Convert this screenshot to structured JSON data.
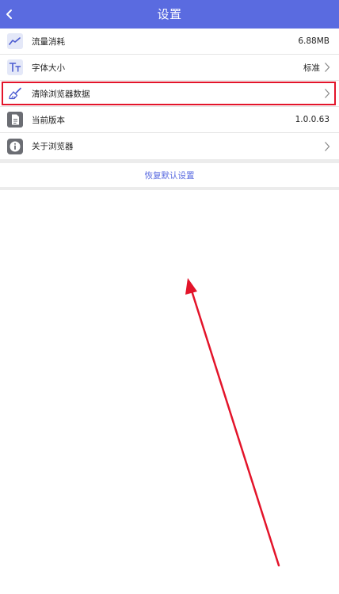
{
  "header": {
    "title": "设置",
    "background": "#5a6be0"
  },
  "settings": {
    "items": [
      {
        "icon": "traffic-chart-icon",
        "label": "流量消耗",
        "value": "6.88MB"
      },
      {
        "icon": "font-size-icon",
        "label": "字体大小",
        "value": "标准"
      },
      {
        "icon": "broom-icon",
        "label": "清除浏览器数据",
        "highlighted": true
      },
      {
        "icon": "document-icon",
        "label": "当前版本",
        "value": "1.0.0.63"
      },
      {
        "icon": "info-icon",
        "label": "关于浏览器"
      }
    ]
  },
  "actions": {
    "reset_label": "恢复默认设置"
  },
  "colors": {
    "accent": "#5a6be0",
    "highlight": "#e3142a",
    "annotation_arrow": "#e3142a"
  }
}
